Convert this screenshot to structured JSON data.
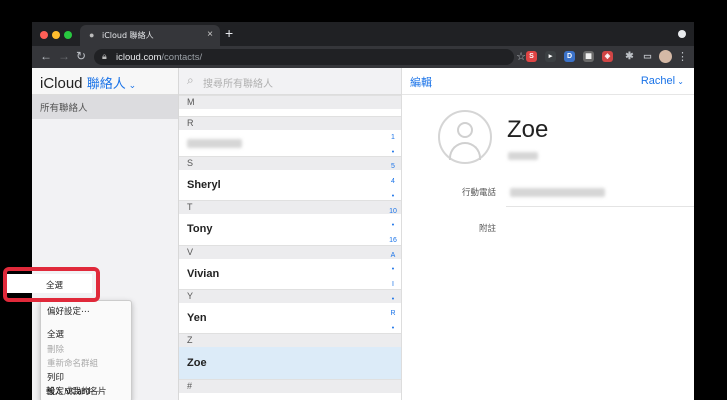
{
  "browser": {
    "tab_title": "iCloud 聯絡人",
    "url_host": "icloud.com",
    "url_path": "/contacts/",
    "extensions": [
      {
        "name": "s-extension-icon",
        "letter": "S",
        "color": "#e04444"
      },
      {
        "name": "play-extension-icon",
        "letter": "▸",
        "color": "#3c4043"
      },
      {
        "name": "d-extension-icon",
        "letter": "D",
        "color": "#3b72c9"
      },
      {
        "name": "grid-extension-icon",
        "letter": "▦",
        "color": "#6a6a6a"
      },
      {
        "name": "shield-extension-icon",
        "letter": "◈",
        "color": "#d04545"
      }
    ]
  },
  "sidebar": {
    "title": "iCloud",
    "title_accent": "聯絡人",
    "group": "所有聯絡人"
  },
  "menu": {
    "items": [
      {
        "label": "偏好設定⋯",
        "dim": false
      },
      {
        "label": "全選",
        "dim": false
      },
      {
        "label": "刪除",
        "dim": true
      },
      {
        "label": "重新命名群組",
        "dim": true
      },
      {
        "label": "列印",
        "dim": false
      },
      {
        "label": "設定成我的名片",
        "dim": false
      },
      {
        "label": "輸入 vCard⋯",
        "dim": false
      }
    ]
  },
  "list": {
    "search_placeholder": "搜尋所有聯絡人",
    "sections": [
      {
        "letter": "M"
      },
      {
        "letter": "R"
      },
      {
        "letter": "S"
      },
      {
        "letter": "T"
      },
      {
        "letter": "V"
      },
      {
        "letter": "Y"
      },
      {
        "letter": "Z"
      },
      {
        "letter": "#"
      }
    ],
    "contacts": [
      {
        "name": ""
      },
      {
        "name": "Sheryl"
      },
      {
        "name": "Tony"
      },
      {
        "name": "Vivian"
      },
      {
        "name": "Yen"
      },
      {
        "name": "Zoe"
      }
    ],
    "index": [
      "1",
      "•",
      "5",
      "4",
      "•",
      "10",
      "•",
      "16",
      "A",
      "•",
      "I",
      "•",
      "R",
      "•"
    ]
  },
  "detail": {
    "edit_label": "編輯",
    "user_label": "Rachel",
    "name": "Zoe",
    "field_phone_label": "行動電話",
    "field_note_label": "附註"
  }
}
